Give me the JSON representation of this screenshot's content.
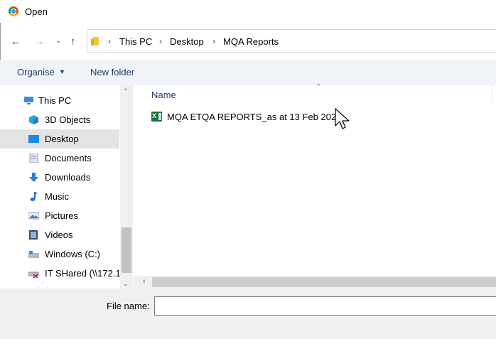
{
  "window": {
    "title": "Open"
  },
  "address": {
    "breadcrumbs": [
      "This PC",
      "Desktop",
      "MQA Reports"
    ]
  },
  "toolbar": {
    "organise_label": "Organise",
    "new_folder_label": "New folder"
  },
  "nav_pane": {
    "items": [
      {
        "label": "This PC",
        "icon": "computer-icon"
      },
      {
        "label": "3D Objects",
        "icon": "cube-icon"
      },
      {
        "label": "Desktop",
        "icon": "desktop-icon",
        "selected": true
      },
      {
        "label": "Documents",
        "icon": "document-icon"
      },
      {
        "label": "Downloads",
        "icon": "download-arrow-icon"
      },
      {
        "label": "Music",
        "icon": "music-note-icon"
      },
      {
        "label": "Pictures",
        "icon": "picture-icon"
      },
      {
        "label": "Videos",
        "icon": "video-icon"
      },
      {
        "label": "Windows (C:)",
        "icon": "drive-icon"
      },
      {
        "label": "IT SHared (\\\\172.1",
        "icon": "network-drive-disconnected-icon"
      }
    ]
  },
  "file_list": {
    "column_name": "Name",
    "files": [
      {
        "name": "MQA ETQA REPORTS_as at 13 Feb 2023",
        "icon": "excel-file-icon"
      }
    ]
  },
  "bottom": {
    "file_name_label": "File name:",
    "file_name_value": ""
  },
  "colors": {
    "accent_text": "#1f3c68",
    "toolbar_bg": "#f0f4f9",
    "selected_bg": "#e3e3e3",
    "excel_green": "#1d6f42"
  }
}
